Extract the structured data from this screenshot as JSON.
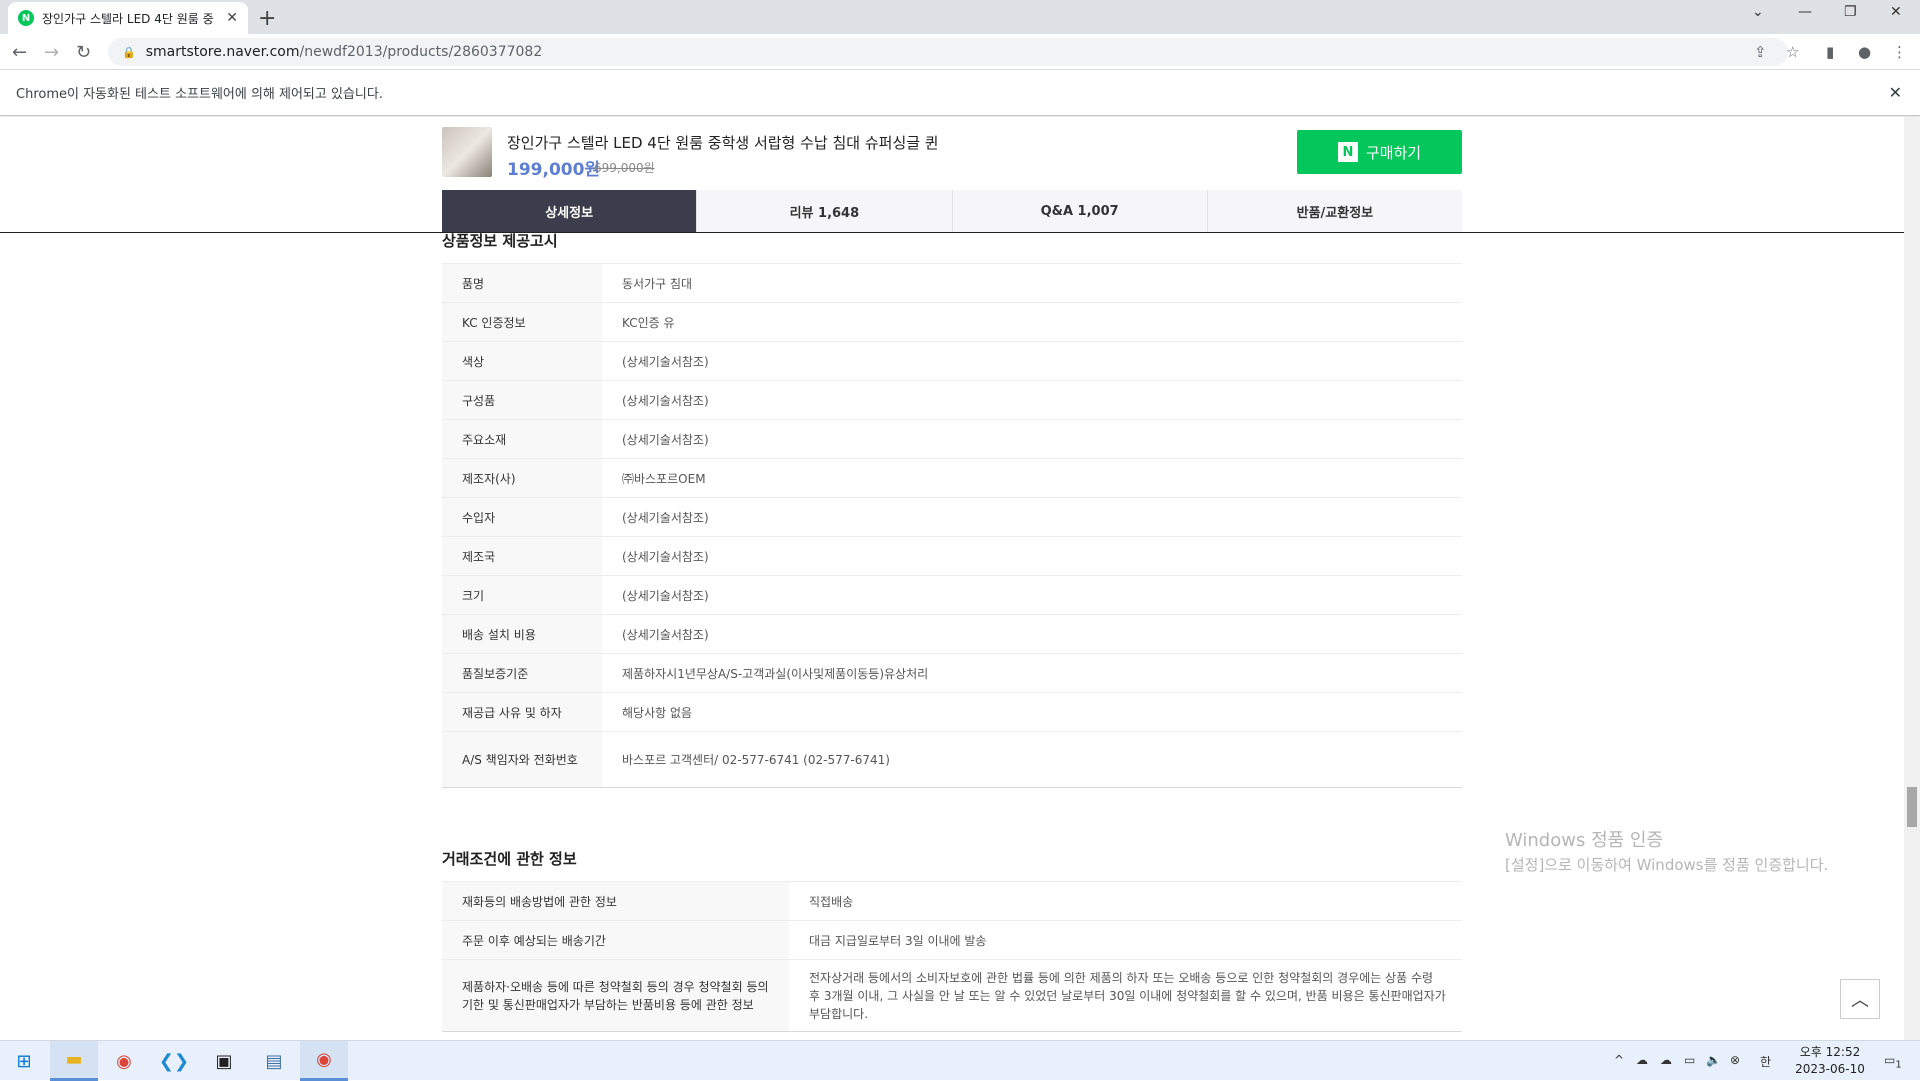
{
  "browser": {
    "tab_title": "장인가구 스텔라 LED 4단 원룸 중",
    "url_host": "smartstore.naver.com",
    "url_path": "/newdf2013/products/2860377082",
    "infobar_text": "Chrome이 자동화된 테스트 소프트웨어에 의해 제어되고 있습니다."
  },
  "product": {
    "name": "장인가구 스텔라 LED 4단 원룸 중학생 서랍형 수납 침대 슈퍼싱글 퀸",
    "price": "199,000원",
    "original_price": "699,000원",
    "buy_label": "구매하기",
    "buy_logo": "N"
  },
  "tabs": [
    {
      "label": "상세정보",
      "active": true
    },
    {
      "label": "리뷰 1,648",
      "active": false
    },
    {
      "label": "Q&A 1,007",
      "active": false
    },
    {
      "label": "반품/교환정보",
      "active": false
    }
  ],
  "notice": {
    "title": "상품정보 제공고시",
    "rows": [
      {
        "k": "품명",
        "v": "동서가구 침대"
      },
      {
        "k": "KC 인증정보",
        "v": "KC인증 유"
      },
      {
        "k": "색상",
        "v": "(상세기술서참조)"
      },
      {
        "k": "구성품",
        "v": "(상세기술서참조)"
      },
      {
        "k": "주요소재",
        "v": "(상세기술서참조)"
      },
      {
        "k": "제조자(사)",
        "v": "㈜바스포르OEM"
      },
      {
        "k": "수입자",
        "v": "(상세기술서참조)"
      },
      {
        "k": "제조국",
        "v": "(상세기술서참조)"
      },
      {
        "k": "크기",
        "v": "(상세기술서참조)"
      },
      {
        "k": "배송 설치 비용",
        "v": "(상세기술서참조)"
      },
      {
        "k": "품질보증기준",
        "v": "제품하자시1년무상A/S-고객과실(이사및제품이동등)유상처리"
      },
      {
        "k": "재공급 사유 및 하자",
        "v": "해당사항 없음"
      },
      {
        "k": "A/S 책임자와 전화번호",
        "v": "바스포르 고객센터/ 02-577-6741 (02-577-6741)"
      }
    ]
  },
  "trade": {
    "title": "거래조건에 관한 정보",
    "rows": [
      {
        "k": "재화등의 배송방법에 관한 정보",
        "v": "직접배송"
      },
      {
        "k": "주문 이후 예상되는 배송기간",
        "v": "대금 지급일로부터 3일 이내에 발송"
      },
      {
        "k": "제품하자·오배송 등에 따른 청약철회 등의 경우 청약철회 등의 기한 및 통신판매업자가 부담하는 반품비용 등에 관한 정보",
        "v": "전자상거래 등에서의 소비자보호에 관한 법률 등에 의한 제품의 하자 또는 오배송 등으로 인한 청약철회의 경우에는 상품 수령 후 3개월 이내, 그 사실을 안 날 또는 알 수 있었던 날로부터 30일 이내에 청약철회를 할 수 있으며, 반품 비용은 통신판매업자가 부담합니다."
      }
    ]
  },
  "watermark": {
    "line1": "Windows 정품 인증",
    "line2": "[설정]으로 이동하여 Windows를 정품 인증합니다."
  },
  "taskbar": {
    "ime": "한",
    "time": "오후 12:52",
    "date": "2023-06-10",
    "notif_count": "1"
  }
}
